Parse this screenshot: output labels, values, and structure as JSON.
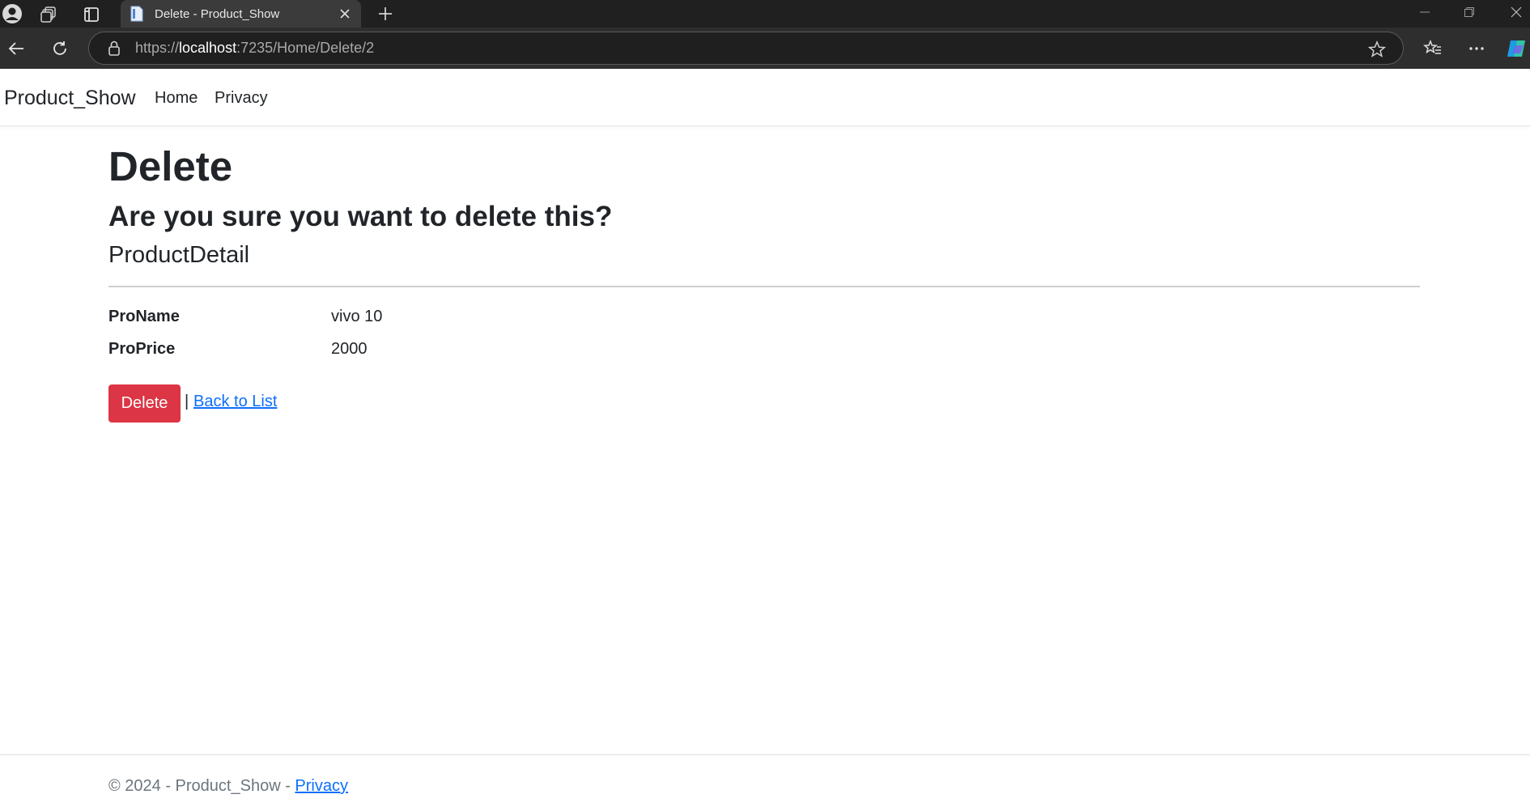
{
  "browser": {
    "tab_title": "Delete - Product_Show",
    "url_scheme": "https://",
    "url_host": "localhost",
    "url_rest": ":7235/Home/Delete/2"
  },
  "navbar": {
    "brand": "Product_Show",
    "links": [
      "Home",
      "Privacy"
    ]
  },
  "page": {
    "title": "Delete",
    "question": "Are you sure you want to delete this?",
    "section": "ProductDetail",
    "fields": [
      {
        "label": "ProName",
        "value": "vivo 10"
      },
      {
        "label": "ProPrice",
        "value": "2000"
      }
    ],
    "delete_label": "Delete",
    "separator": "|",
    "back_label": "Back to List"
  },
  "footer": {
    "text": "© 2024 - Product_Show - ",
    "link": "Privacy"
  },
  "colors": {
    "danger": "#dc3545",
    "link": "#0d6efd",
    "chrome_dark": "#202020"
  }
}
